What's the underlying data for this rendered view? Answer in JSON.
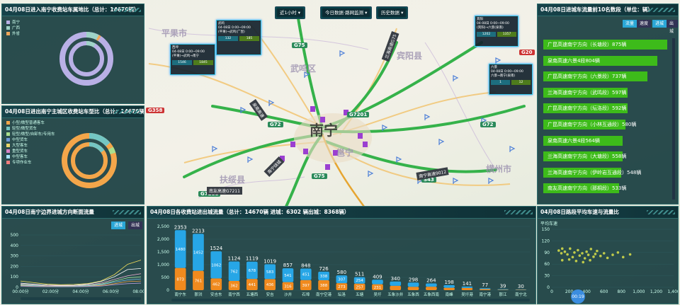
{
  "top_controls": {
    "time_select": "近1小时",
    "data_select": "今日数据·路网监测",
    "history_select": "历史数据"
  },
  "panel_tl": {
    "title": "04月08日进入南宁收费站车属地比（总计：14670辆）",
    "legend": [
      {
        "label": "南宁",
        "color": "#b9b0e6"
      },
      {
        "label": "广西",
        "color": "#9fd3c7"
      },
      {
        "label": "外省",
        "color": "#f0a75b"
      }
    ]
  },
  "panel_ml": {
    "title": "04月08日进出南宁主城区收费站车型比（总计：14670辆）",
    "legend": [
      {
        "label": "小型/微型普通客车",
        "color": "#f4a64a"
      },
      {
        "label": "轻型/微型货车",
        "color": "#74c6c3"
      },
      {
        "label": "轻型/微型/自卸车/专用车",
        "color": "#aadf8d"
      },
      {
        "label": "中型货车",
        "color": "#6e98d8"
      },
      {
        "label": "大型客车",
        "color": "#e9d66b"
      },
      {
        "label": "重型货车",
        "color": "#d884c6"
      },
      {
        "label": "中型客车",
        "color": "#a7e6ff"
      },
      {
        "label": "专项作业车",
        "color": "#f07e7e"
      }
    ]
  },
  "panel_bl": {
    "title": "04月08日南宁边界进城方向断面流量",
    "toggle_in": "进城",
    "toggle_out": "出城",
    "y_ticks": [
      "500",
      "400",
      "300",
      "200",
      "100",
      "0"
    ],
    "x_ticks": [
      "00:00分",
      "02:00分",
      "04:00分",
      "06:00分",
      "08:00分"
    ]
  },
  "panel_bc": {
    "title": "04月08日各收费站进出城流量（总计：14670辆 进城：6302 辆出城：8368辆）",
    "y_ticks": [
      "2,500",
      "2,000",
      "1,500",
      "1,000",
      "500",
      "0"
    ]
  },
  "chart_data": {
    "type": "bar",
    "categories": [
      "南宁东",
      "那洪",
      "安吉东",
      "南宁西",
      "五塘西",
      "安吉",
      "沙井",
      "石埠",
      "南宁空港",
      "坛洛",
      "五塘",
      "吴圩",
      "五象沙井",
      "五象西",
      "五象西南",
      "南峰",
      "吴圩港",
      "南宁港",
      "那江",
      "南宁北"
    ],
    "totals": [
      2353,
      2213,
      1524,
      1124,
      1119,
      1019,
      857,
      848,
      726,
      580,
      511,
      409,
      340,
      298,
      264,
      198,
      141,
      77,
      39,
      30
    ],
    "series": [
      {
        "values": [
          1480,
          1452,
          1062,
          762,
          678,
          583,
          541,
          451,
          338,
          307,
          254,
          178,
          170,
          166,
          130,
          103,
          53,
          35,
          20,
          12
        ]
      },
      {
        "values": [
          873,
          761,
          462,
          362,
          441,
          436,
          316,
          397,
          388,
          273,
          257,
          231,
          170,
          132,
          134,
          95,
          88,
          42,
          19,
          18
        ]
      }
    ],
    "ylim": [
      0,
      2500
    ]
  },
  "panel_tr": {
    "title": "04月08日进城车流量前10名数段（单位：辆）",
    "toggles": [
      "流量",
      "速度",
      "进城",
      "出城"
    ],
    "items": [
      {
        "label": "广昆高速南宁方向（长塘段）875辆",
        "fill": 1.0
      },
      {
        "label": "泉南高速六景4段804辆",
        "fill": 0.92
      },
      {
        "label": "广昆高速南宁方向（六景段）737辆",
        "fill": 0.84
      },
      {
        "label": "兰海高速南宁方向（武鸣段）597辆",
        "fill": 0.68
      },
      {
        "label": "广昆高速南宁方向（坛洛段）592辆",
        "fill": 0.68
      },
      {
        "label": "广昆高速南宁方向（小林互通段）580辆",
        "fill": 0.66
      },
      {
        "label": "泉南高速六景4段564辆",
        "fill": 0.64
      },
      {
        "label": "兰海高速南宁方向（大塘段）558辆",
        "fill": 0.64
      },
      {
        "label": "兰海高速南宁方向（伊岭岩互通段）548辆",
        "fill": 0.63
      },
      {
        "label": "南友高速南宁方向（那桐段）533辆",
        "fill": 0.61
      }
    ]
  },
  "panel_br": {
    "title": "04月08日路段平均车速与流量比",
    "y_label": "平均车速",
    "y_ticks": [
      "150",
      "120",
      "90",
      "60",
      "30",
      "0"
    ],
    "x_ticks": [
      "0",
      "200",
      "400",
      "600",
      "800",
      "1,000",
      "1,200",
      "1,400"
    ],
    "time_badge": "00:19"
  },
  "map": {
    "cities": [
      {
        "name": "平果市"
      },
      {
        "name": "武鸣区"
      },
      {
        "name": "宾阳县"
      },
      {
        "name": "南宁"
      },
      {
        "name": "邕宁"
      },
      {
        "name": "扶绥县"
      },
      {
        "name": "横州市"
      }
    ],
    "shields": [
      {
        "label": "G75"
      },
      {
        "label": "G72"
      },
      {
        "label": "G7201"
      },
      {
        "label": "G7211"
      },
      {
        "label": "G75"
      },
      {
        "label": "S43"
      },
      {
        "label": "G72"
      }
    ],
    "red_shields": [
      {
        "label": "G358"
      },
      {
        "label": "G20"
      }
    ],
    "road_labels": [
      {
        "label": "南友高速G7211"
      },
      {
        "label": "南宁高速9012"
      },
      {
        "label": "兰海高速G75"
      },
      {
        "label": "泉南高速"
      },
      {
        "label": "南宁绕城"
      }
    ],
    "cards": [
      {
        "title": "武鸣",
        "line1": "04-08日 0:00~09:00",
        "line2": "(平果)→武鸣(广昆)",
        "in": "132",
        "out": "185"
      },
      {
        "title": "西坪",
        "line1": "04-08日 0:00~09:00",
        "line2": "(平果)→武鸣→南宁",
        "in": "1546",
        "out": "1845"
      },
      {
        "title": "宾阳",
        "line1": "04-08日 0:00~09:00",
        "line2": "(宾阳)→六景(泉南)",
        "in": "1202",
        "out": "1357"
      },
      {
        "title": "六景",
        "line1": "04-08日 0:00~09:00",
        "line2": "六景→南宁(泉南)",
        "in": "1",
        "out": "12"
      }
    ]
  }
}
